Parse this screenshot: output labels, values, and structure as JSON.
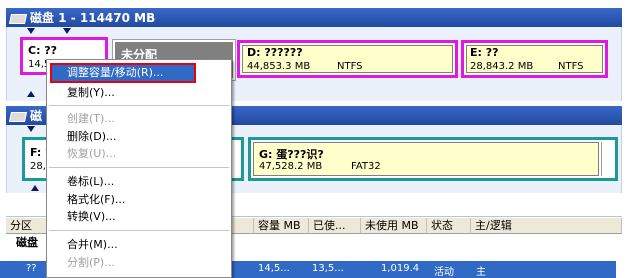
{
  "disk1": {
    "title": "磁盘 1 - 114470 MB"
  },
  "disk2": {
    "title": "磁"
  },
  "partitions_disk1": [
    {
      "name": "C: ??",
      "size": "14,5"
    },
    {
      "name": "未分配"
    },
    {
      "name": "D: ??????",
      "size": "44,853.3 MB",
      "fs": "NTFS"
    },
    {
      "name": "E: ??",
      "size": "28,843.2 MB",
      "fs": "NTFS"
    }
  ],
  "partitions_disk2": [
    {
      "name": "F: ?",
      "size": "28,7"
    },
    {
      "name": "G: 蛋???识?",
      "size": "47,528.2 MB",
      "fs": "FAT32"
    }
  ],
  "context_menu": {
    "highlighted": "调整容量/移动(R)...",
    "items": [
      {
        "label": "复制(Y)...",
        "enabled": true
      },
      {
        "label": "创建(T)...",
        "enabled": false
      },
      {
        "label": "删除(D)...",
        "enabled": true
      },
      {
        "label": "恢复(U)...",
        "enabled": false
      },
      {
        "label": "卷标(L)...",
        "enabled": true
      },
      {
        "label": "格式化(F)...",
        "enabled": true
      },
      {
        "label": "转换(V)...",
        "enabled": true
      },
      {
        "label": "合并(M)...",
        "enabled": true
      },
      {
        "label": "分割(P)...",
        "enabled": false
      }
    ]
  },
  "table": {
    "headers": [
      "分区",
      "容量 MB",
      "已使...",
      "未使用 MB",
      "状态",
      "主/逻辑"
    ],
    "disk_row": "磁盘",
    "selected_row": [
      "??",
      "14,5...",
      "13,5...",
      "1,019.4",
      "活动",
      "主"
    ]
  },
  "colors": {
    "header_blue": "#2a56b3",
    "select_blue": "#316ac5",
    "pink": "#e019e0",
    "teal": "#1a9a9a",
    "highlight_border": "#e60012"
  }
}
